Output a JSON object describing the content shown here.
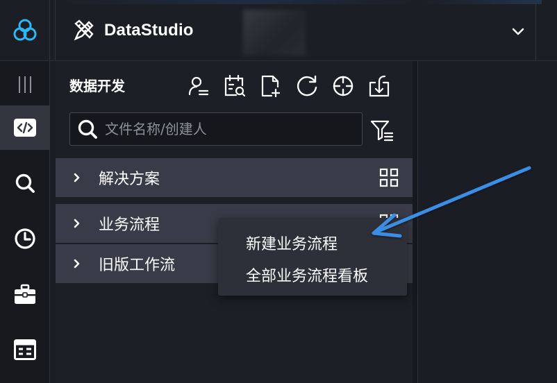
{
  "app": {
    "title": "DataStudio"
  },
  "panel": {
    "title": "数据开发",
    "toolbar_icons": [
      "user-icon",
      "calendar-search-icon",
      "new-file-icon",
      "refresh-icon",
      "crosshair-icon",
      "import-icon"
    ],
    "search": {
      "placeholder": "文件名称/创建人",
      "value": ""
    },
    "tree": [
      {
        "label": "解决方案"
      },
      {
        "label": "业务流程"
      },
      {
        "label": "旧版工作流"
      }
    ]
  },
  "context_menu": {
    "items": [
      {
        "label": "新建业务流程"
      },
      {
        "label": "全部业务流程看板"
      }
    ]
  },
  "rail": {
    "items": [
      "menu-lines-icon",
      "code-icon",
      "search-icon",
      "clock-icon",
      "briefcase-icon",
      "table-icon"
    ],
    "active": "code-icon"
  },
  "colors": {
    "brand": "#2db7f5",
    "annotation_arrow": "#3a8ee6"
  }
}
